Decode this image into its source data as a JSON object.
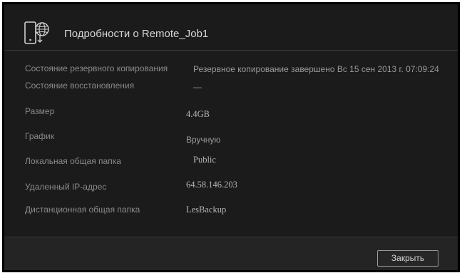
{
  "dialog": {
    "title": "Подробности о Remote_Job1",
    "icon": "phone-globe-icon",
    "fields": [
      {
        "label": "Состояние резервного копирования",
        "value": "Резервное копирование завершено Вс 15 сен 2013 г. 07:09:24"
      },
      {
        "label": "Состояние восстановления",
        "value": "—"
      },
      {
        "label": "Размер",
        "value": "4.4GB"
      },
      {
        "label": "График",
        "value": "Вручную"
      },
      {
        "label": "Локальная общая папка",
        "value": "Public"
      },
      {
        "label": "Удаленный IP-адрес",
        "value": "64.58.146.203"
      },
      {
        "label": "Дистанционная общая папка",
        "value": "LesBackup"
      }
    ],
    "close_label": "Закрыть"
  }
}
